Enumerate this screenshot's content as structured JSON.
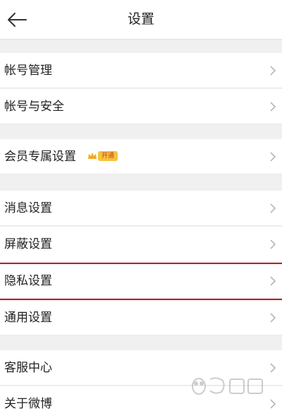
{
  "header": {
    "title": "设置"
  },
  "rows": {
    "account_manage": "帐号管理",
    "account_security": "帐号与安全",
    "vip_settings": "会员专属设置",
    "vip_badge": "开通",
    "message": "消息设置",
    "block": "屏蔽设置",
    "privacy": "隐私设置",
    "general": "通用设置",
    "service": "客服中心",
    "about": "关于微博"
  },
  "colors": {
    "highlight": "#d0111b",
    "badge": "#f7c23a",
    "chevron": "#b0b0b0"
  },
  "icons": {
    "back": "back-arrow-icon",
    "chevron": "chevron-right-icon",
    "crown": "crown-icon"
  }
}
